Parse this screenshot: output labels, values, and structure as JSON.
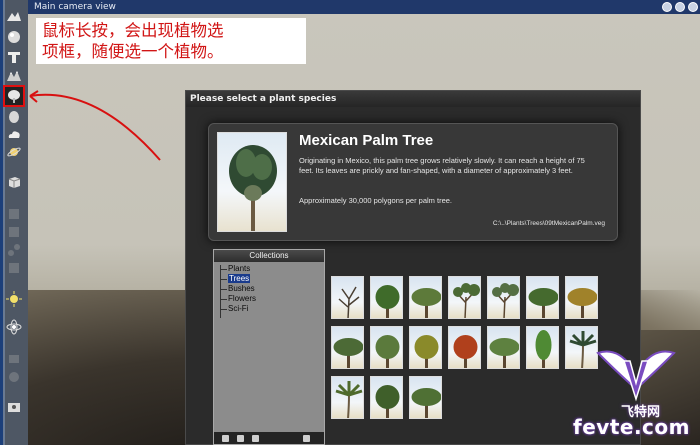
{
  "viewport": {
    "title": "Main camera view"
  },
  "annotation": {
    "text": "鼠标长按，会出现植物选\n项框，随便选一个植物。",
    "color": "#d11515"
  },
  "toolbar": {
    "tools": [
      {
        "icon": "terrain-icon",
        "active": false
      },
      {
        "icon": "sphere-icon",
        "active": false
      },
      {
        "icon": "text-icon",
        "active": false
      },
      {
        "icon": "mountain-icon",
        "active": false
      },
      {
        "icon": "plant-icon",
        "active": true
      },
      {
        "icon": "rock-icon",
        "active": false
      },
      {
        "icon": "cloud-icon",
        "active": false
      },
      {
        "icon": "planet-icon",
        "active": false
      },
      {
        "icon": "cube-icon",
        "active": false
      },
      {
        "icon": "light-icon",
        "active": false
      },
      {
        "icon": "render-icon",
        "active": false
      }
    ]
  },
  "dialog": {
    "title": "Please select a plant species",
    "plant": {
      "name": "Mexican Palm Tree",
      "description": "Originating in Mexico, this palm tree grows relatively slowly. It can reach a height of 75 feet. Its leaves are prickly and fan-shaped, with a diameter of approximately 3 feet.",
      "polygons": "Approximately 30,000 polygons per palm tree.",
      "path": "C:\\..\\Plants\\Trees\\09tMexicanPalm.veg"
    },
    "collections": {
      "header": "Collections",
      "items": [
        {
          "label": "Plants",
          "selected": false
        },
        {
          "label": "Trees",
          "selected": true
        },
        {
          "label": "Bushes",
          "selected": false
        },
        {
          "label": "Flowers",
          "selected": false
        },
        {
          "label": "Sci-Fi",
          "selected": false
        }
      ]
    },
    "thumbnails": [
      {
        "type": "dead",
        "color": "#4a3f33"
      },
      {
        "type": "round",
        "color": "#3f6b2a"
      },
      {
        "type": "broad",
        "color": "#5d7a3a"
      },
      {
        "type": "sparse",
        "color": "#4b6a35"
      },
      {
        "type": "sparse",
        "color": "#556f44"
      },
      {
        "type": "broad",
        "color": "#456a2e"
      },
      {
        "type": "broad",
        "color": "#a0822a"
      },
      {
        "type": "broad",
        "color": "#4c6a36"
      },
      {
        "type": "round",
        "color": "#5b7a3c"
      },
      {
        "type": "round",
        "color": "#8a8a2a"
      },
      {
        "type": "round",
        "color": "#b0401c"
      },
      {
        "type": "broad",
        "color": "#5e8140"
      },
      {
        "type": "tall",
        "color": "#4f8a34"
      },
      {
        "type": "palm",
        "color": "#2f4a32"
      },
      {
        "type": "palm",
        "color": "#4f6a2c"
      },
      {
        "type": "round",
        "color": "#3f5f2a"
      },
      {
        "type": "broad",
        "color": "#4f7034"
      }
    ]
  },
  "watermark": {
    "cn": "飞特网",
    "en": "fevte.com",
    "color": "#7a4cc0"
  }
}
